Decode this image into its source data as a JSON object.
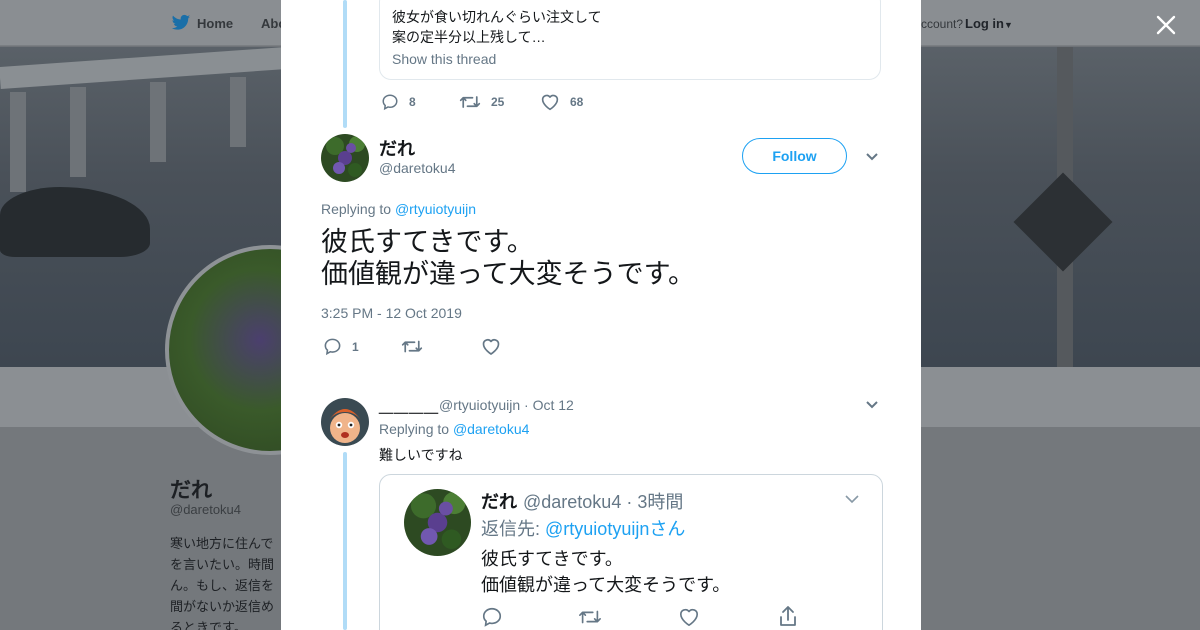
{
  "nav": {
    "home_label": "Home",
    "about_label": "Abo",
    "account_prompt": "ccount?",
    "login_label": "Log in"
  },
  "profile": {
    "name": "だれ",
    "handle": "@daretoku4",
    "bio": "寒い地方に住んで\nを言いたい。時間\nん。もし、返信を\n間がないか返信め\nるときです。"
  },
  "top_quote": {
    "line1": "彼女が食い切れんぐらい注文して",
    "line2": "案の定半分以上残して…",
    "show_thread": "Show this thread"
  },
  "top_actions": {
    "replies": "8",
    "retweets": "25",
    "likes": "68"
  },
  "main_tweet": {
    "name": "だれ",
    "handle": "@daretoku4",
    "follow_label": "Follow",
    "replying_prefix": "Replying to",
    "replying_to": "@rtyuiotyuijn",
    "text": "彼氏すてきです。\n価値観が違って大変そうです。",
    "timestamp": "3:25 PM - 12 Oct 2019",
    "replies": "1"
  },
  "reply_tweet": {
    "name": "＿＿＿＿",
    "handle_date": "@rtyuiotyuijn · Oct 12",
    "replying_prefix": "Replying to",
    "replying_to": "@daretoku4",
    "text": "難しいですね"
  },
  "embedded_tweet": {
    "name": "だれ",
    "handle_time": "@daretoku4 · 3時間",
    "replying_prefix": "返信先:",
    "replying_to": "@rtyuiotyuijnさん",
    "text": "彼氏すてきです。\n価値観が違って大変そうです。"
  },
  "colors": {
    "accent": "#1da1f2",
    "thread_line": "#b1dcf7",
    "secondary_text": "#657786"
  }
}
